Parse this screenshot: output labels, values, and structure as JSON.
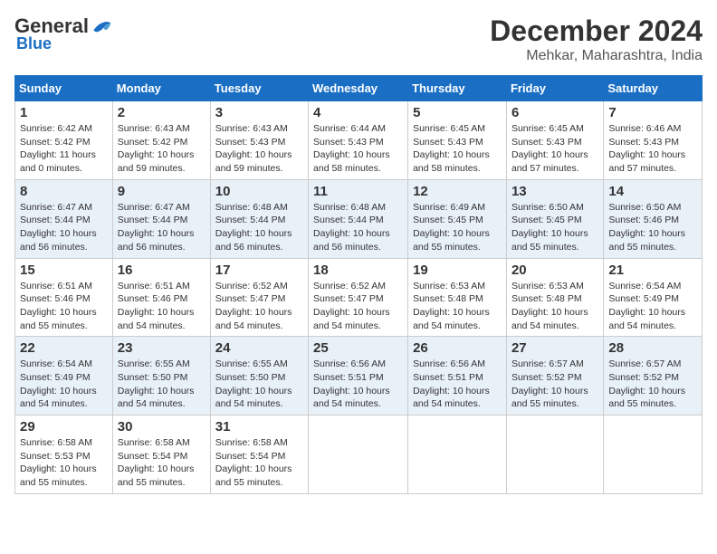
{
  "header": {
    "logo_general": "General",
    "logo_blue": "Blue",
    "month_title": "December 2024",
    "location": "Mehkar, Maharashtra, India"
  },
  "calendar": {
    "days_of_week": [
      "Sunday",
      "Monday",
      "Tuesday",
      "Wednesday",
      "Thursday",
      "Friday",
      "Saturday"
    ],
    "weeks": [
      [
        {
          "day": "",
          "info": ""
        },
        {
          "day": "2",
          "info": "Sunrise: 6:43 AM\nSunset: 5:42 PM\nDaylight: 10 hours\nand 59 minutes."
        },
        {
          "day": "3",
          "info": "Sunrise: 6:43 AM\nSunset: 5:43 PM\nDaylight: 10 hours\nand 59 minutes."
        },
        {
          "day": "4",
          "info": "Sunrise: 6:44 AM\nSunset: 5:43 PM\nDaylight: 10 hours\nand 58 minutes."
        },
        {
          "day": "5",
          "info": "Sunrise: 6:45 AM\nSunset: 5:43 PM\nDaylight: 10 hours\nand 58 minutes."
        },
        {
          "day": "6",
          "info": "Sunrise: 6:45 AM\nSunset: 5:43 PM\nDaylight: 10 hours\nand 57 minutes."
        },
        {
          "day": "7",
          "info": "Sunrise: 6:46 AM\nSunset: 5:43 PM\nDaylight: 10 hours\nand 57 minutes."
        }
      ],
      [
        {
          "day": "1",
          "info": "Sunrise: 6:42 AM\nSunset: 5:42 PM\nDaylight: 11 hours\nand 0 minutes.",
          "is_first": true
        },
        {
          "day": "",
          "info": ""
        },
        {
          "day": "",
          "info": ""
        },
        {
          "day": "",
          "info": ""
        },
        {
          "day": "",
          "info": ""
        },
        {
          "day": "",
          "info": ""
        },
        {
          "day": "",
          "info": ""
        }
      ],
      [
        {
          "day": "8",
          "info": "Sunrise: 6:47 AM\nSunset: 5:44 PM\nDaylight: 10 hours\nand 56 minutes."
        },
        {
          "day": "9",
          "info": "Sunrise: 6:47 AM\nSunset: 5:44 PM\nDaylight: 10 hours\nand 56 minutes."
        },
        {
          "day": "10",
          "info": "Sunrise: 6:48 AM\nSunset: 5:44 PM\nDaylight: 10 hours\nand 56 minutes."
        },
        {
          "day": "11",
          "info": "Sunrise: 6:48 AM\nSunset: 5:44 PM\nDaylight: 10 hours\nand 56 minutes."
        },
        {
          "day": "12",
          "info": "Sunrise: 6:49 AM\nSunset: 5:45 PM\nDaylight: 10 hours\nand 55 minutes."
        },
        {
          "day": "13",
          "info": "Sunrise: 6:50 AM\nSunset: 5:45 PM\nDaylight: 10 hours\nand 55 minutes."
        },
        {
          "day": "14",
          "info": "Sunrise: 6:50 AM\nSunset: 5:46 PM\nDaylight: 10 hours\nand 55 minutes."
        }
      ],
      [
        {
          "day": "15",
          "info": "Sunrise: 6:51 AM\nSunset: 5:46 PM\nDaylight: 10 hours\nand 55 minutes."
        },
        {
          "day": "16",
          "info": "Sunrise: 6:51 AM\nSunset: 5:46 PM\nDaylight: 10 hours\nand 54 minutes."
        },
        {
          "day": "17",
          "info": "Sunrise: 6:52 AM\nSunset: 5:47 PM\nDaylight: 10 hours\nand 54 minutes."
        },
        {
          "day": "18",
          "info": "Sunrise: 6:52 AM\nSunset: 5:47 PM\nDaylight: 10 hours\nand 54 minutes."
        },
        {
          "day": "19",
          "info": "Sunrise: 6:53 AM\nSunset: 5:48 PM\nDaylight: 10 hours\nand 54 minutes."
        },
        {
          "day": "20",
          "info": "Sunrise: 6:53 AM\nSunset: 5:48 PM\nDaylight: 10 hours\nand 54 minutes."
        },
        {
          "day": "21",
          "info": "Sunrise: 6:54 AM\nSunset: 5:49 PM\nDaylight: 10 hours\nand 54 minutes."
        }
      ],
      [
        {
          "day": "22",
          "info": "Sunrise: 6:54 AM\nSunset: 5:49 PM\nDaylight: 10 hours\nand 54 minutes."
        },
        {
          "day": "23",
          "info": "Sunrise: 6:55 AM\nSunset: 5:50 PM\nDaylight: 10 hours\nand 54 minutes."
        },
        {
          "day": "24",
          "info": "Sunrise: 6:55 AM\nSunset: 5:50 PM\nDaylight: 10 hours\nand 54 minutes."
        },
        {
          "day": "25",
          "info": "Sunrise: 6:56 AM\nSunset: 5:51 PM\nDaylight: 10 hours\nand 54 minutes."
        },
        {
          "day": "26",
          "info": "Sunrise: 6:56 AM\nSunset: 5:51 PM\nDaylight: 10 hours\nand 54 minutes."
        },
        {
          "day": "27",
          "info": "Sunrise: 6:57 AM\nSunset: 5:52 PM\nDaylight: 10 hours\nand 55 minutes."
        },
        {
          "day": "28",
          "info": "Sunrise: 6:57 AM\nSunset: 5:52 PM\nDaylight: 10 hours\nand 55 minutes."
        }
      ],
      [
        {
          "day": "29",
          "info": "Sunrise: 6:58 AM\nSunset: 5:53 PM\nDaylight: 10 hours\nand 55 minutes."
        },
        {
          "day": "30",
          "info": "Sunrise: 6:58 AM\nSunset: 5:54 PM\nDaylight: 10 hours\nand 55 minutes."
        },
        {
          "day": "31",
          "info": "Sunrise: 6:58 AM\nSunset: 5:54 PM\nDaylight: 10 hours\nand 55 minutes."
        },
        {
          "day": "",
          "info": ""
        },
        {
          "day": "",
          "info": ""
        },
        {
          "day": "",
          "info": ""
        },
        {
          "day": "",
          "info": ""
        }
      ]
    ]
  }
}
